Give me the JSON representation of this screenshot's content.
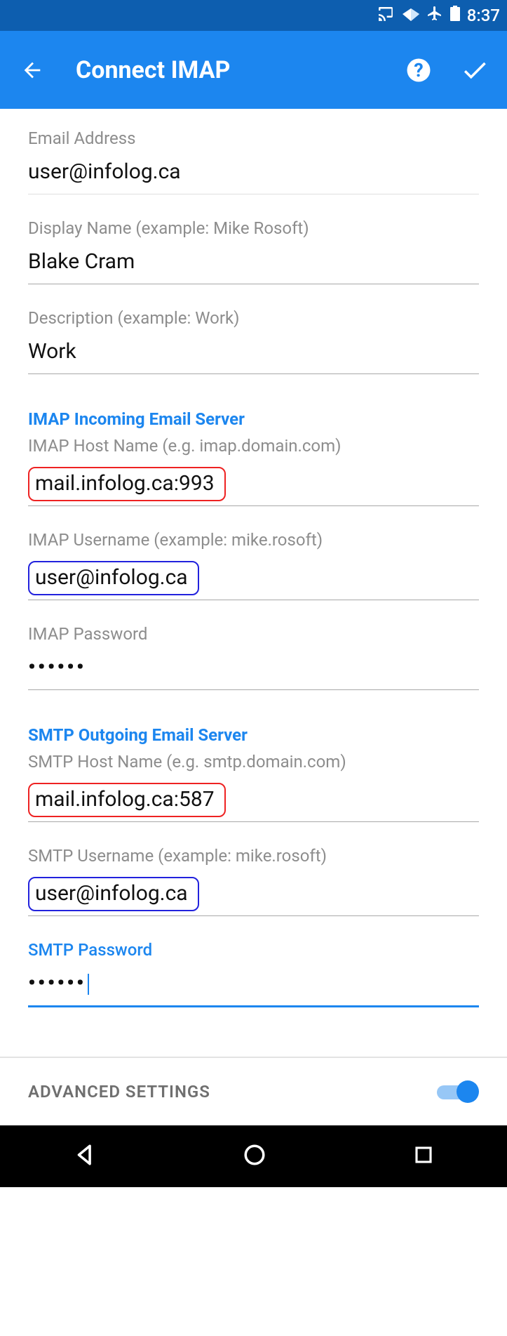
{
  "status": {
    "time": "8:37"
  },
  "appbar": {
    "title": "Connect IMAP"
  },
  "fields": {
    "email": {
      "label": "Email Address",
      "value": "user@infolog.ca"
    },
    "display_name": {
      "label": "Display Name (example: Mike Rosoft)",
      "value": "Blake Cram"
    },
    "description": {
      "label": "Description (example: Work)",
      "value": "Work"
    }
  },
  "imap": {
    "section": "IMAP Incoming Email Server",
    "host": {
      "label": "IMAP Host Name (e.g. imap.domain.com)",
      "value": "mail.infolog.ca:993"
    },
    "user": {
      "label": "IMAP Username (example: mike.rosoft)",
      "value": "user@infolog.ca"
    },
    "pass": {
      "label": "IMAP Password",
      "value": "••••••"
    }
  },
  "smtp": {
    "section": "SMTP Outgoing Email Server",
    "host": {
      "label": "SMTP Host Name (e.g. smtp.domain.com)",
      "value": "mail.infolog.ca:587"
    },
    "user": {
      "label": "SMTP Username (example: mike.rosoft)",
      "value": "user@infolog.ca"
    },
    "pass": {
      "label": "SMTP Password",
      "value": "••••••"
    }
  },
  "advanced": {
    "label": "ADVANCED SETTINGS",
    "enabled": true
  }
}
